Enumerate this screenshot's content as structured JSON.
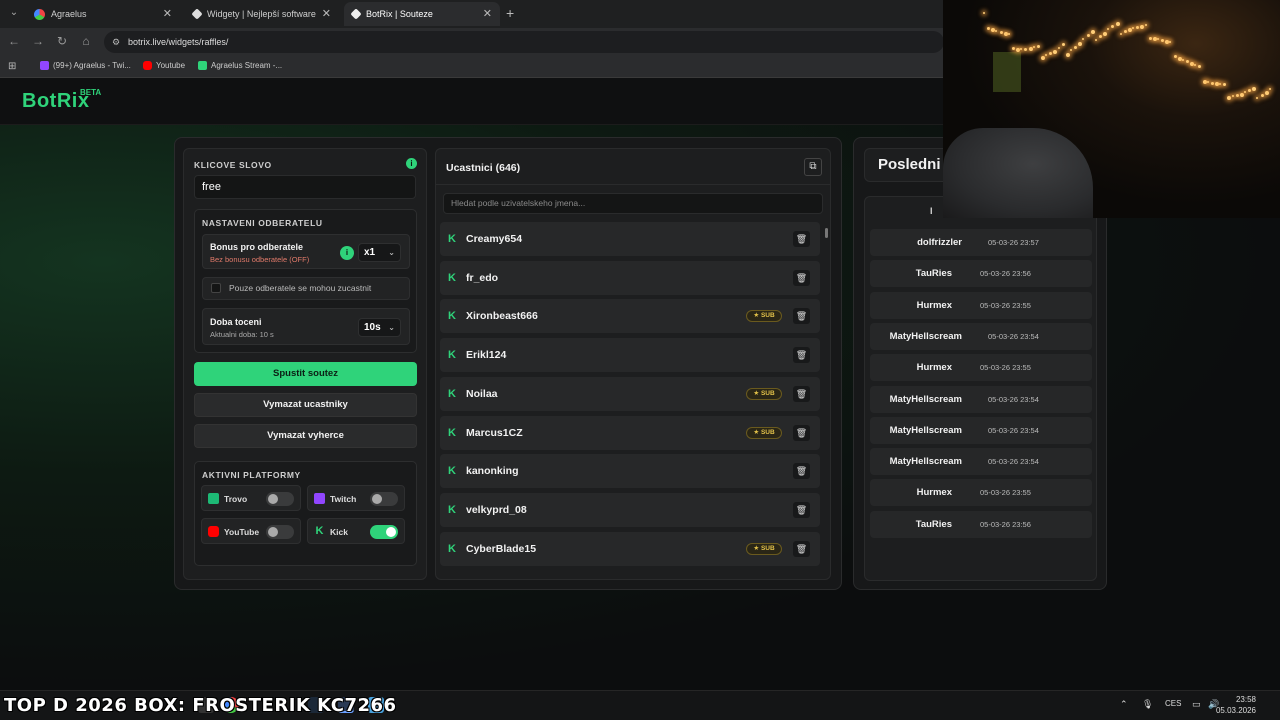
{
  "browser": {
    "tabs": [
      {
        "label": "Agraelus"
      },
      {
        "label": "Widgety | Nejlepší software pro"
      },
      {
        "label": "BotRix | Souteze"
      }
    ],
    "url": "botrix.live/widgets/raffles/",
    "bookmarks": [
      {
        "label": "(99+) Agraelus - Twi..."
      },
      {
        "label": "Youtube"
      },
      {
        "label": "Agraelus Stream -..."
      }
    ]
  },
  "site": {
    "logo": "BotRix",
    "beta": "BETA"
  },
  "settings": {
    "keyword_label": "KLICOVE SLOVO",
    "keyword_value": "free",
    "subscriber_section": "NASTAVENI ODBERATELU",
    "bonus_title": "Bonus pro odberatele",
    "bonus_sub": "Bez bonusu odberatele (OFF)",
    "bonus_value": "x1",
    "only_subs_label": "Pouze odberatele se mohou zucastnit",
    "spin_title": "Doba toceni",
    "spin_sub": "Aktualni doba: 10 s",
    "spin_value": "10s",
    "start_button": "Spustit soutez",
    "clear_participants_button": "Vymazat ucastniky",
    "clear_winners_button": "Vymazat vyherce",
    "platforms_label": "AKTIVNI PLATFORMY",
    "platforms": [
      {
        "name": "Trovo",
        "enabled": false
      },
      {
        "name": "Twitch",
        "enabled": false
      },
      {
        "name": "YouTube",
        "enabled": false
      },
      {
        "name": "Kick",
        "enabled": true
      }
    ]
  },
  "participants": {
    "title": "Ucastnici (646)",
    "search_placeholder": "Hledat podle uzivatelskeho jmena...",
    "sub_badge": "SUB",
    "list": [
      {
        "name": "Creamy654",
        "sub": false
      },
      {
        "name": "fr_edo",
        "sub": false
      },
      {
        "name": "Xironbeast666",
        "sub": true
      },
      {
        "name": "Erikl124",
        "sub": false
      },
      {
        "name": "Noilaa",
        "sub": true
      },
      {
        "name": "Marcus1CZ",
        "sub": true
      },
      {
        "name": "kanonking",
        "sub": false
      },
      {
        "name": "velkyprd_08",
        "sub": false
      },
      {
        "name": "CyberBlade15",
        "sub": true
      }
    ]
  },
  "winners": {
    "title": "Posledni",
    "header_fragment": "l",
    "list": [
      {
        "name": "dolfrizzler",
        "time": "05-03-26 23:57"
      },
      {
        "name": "TauRies",
        "time": "05-03-26 23:56"
      },
      {
        "name": "Hurmex",
        "time": "05-03-26 23:55"
      },
      {
        "name": "MatyHellscream",
        "time": "05-03-26 23:54"
      },
      {
        "name": "Hurmex",
        "time": "05-03-26 23:55"
      },
      {
        "name": "MatyHellscream",
        "time": "05-03-26 23:54"
      },
      {
        "name": "MatyHellscream",
        "time": "05-03-26 23:54"
      },
      {
        "name": "MatyHellscream",
        "time": "05-03-26 23:54"
      },
      {
        "name": "Hurmex",
        "time": "05-03-26 23:55"
      },
      {
        "name": "TauRies",
        "time": "05-03-26 23:56"
      }
    ]
  },
  "taskbar": {
    "overlay_text": "TOP D 2026 BOX: FROSTERIK KC7266",
    "lang": "CES",
    "time": "23:58",
    "date": "05.03.2026"
  },
  "colors": {
    "accent": "#2fd37a",
    "sub_badge": "#e3c24a"
  }
}
